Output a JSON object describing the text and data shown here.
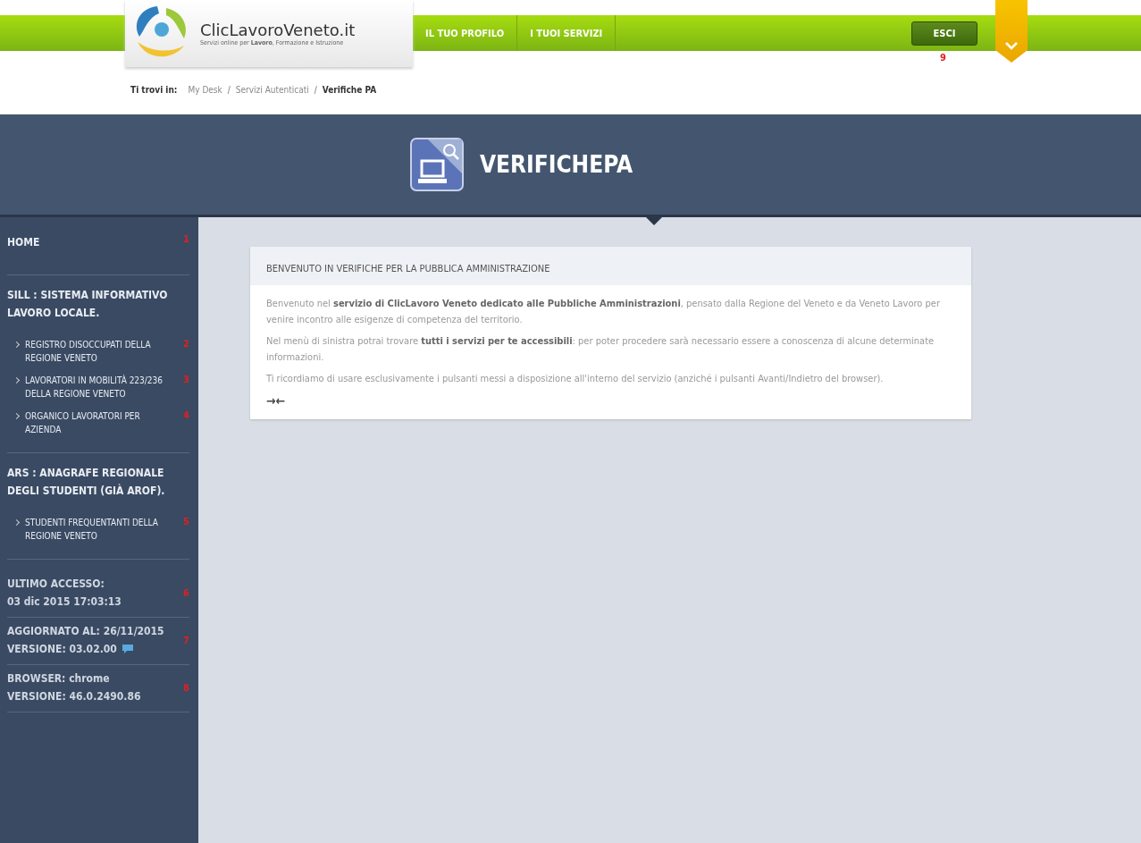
{
  "header": {
    "logo_title": "ClicLavoroVeneto.it",
    "logo_subtitle": "Servizi online per **Lavoro**, Formazione e Istruzione",
    "nav": [
      {
        "label": "IL TUO PROFILO"
      },
      {
        "label": "I TUOI SERVIZI"
      }
    ],
    "logout": {
      "label": "ESCI",
      "marker": "9"
    }
  },
  "breadcrumb": {
    "label": "Ti trovi in:",
    "items": [
      {
        "text": "My Desk",
        "current": false
      },
      {
        "text": "Servizi Autenticati",
        "current": false
      },
      {
        "text": "Verifiche PA",
        "current": true
      }
    ],
    "separator": "/"
  },
  "banner": {
    "title": "VERIFICHEPA"
  },
  "sidebar": {
    "sections": [
      {
        "title": "HOME",
        "marker": "1"
      },
      {
        "title": "SILL : SISTEMA INFORMATIVO LAVORO LOCALE.",
        "items": [
          {
            "label": "REGISTRO DISOCCUPATI DELLA REGIONE VENETO",
            "marker": "2"
          },
          {
            "label": "LAVORATORI IN MOBILITÀ 223/236 DELLA REGIONE VENETO",
            "marker": "3"
          },
          {
            "label": "ORGANICO LAVORATORI PER AZIENDA",
            "marker": "4"
          }
        ]
      },
      {
        "title": "ARS : ANAGRAFE REGIONALE DEGLI STUDENTI (GIÀ AROF).",
        "items": [
          {
            "label": "STUDENTI FREQUENTANTI DELLA REGIONE VENETO",
            "marker": "5"
          }
        ]
      }
    ],
    "info": [
      {
        "lines": [
          "ULTIMO ACCESSO:",
          "03 dic 2015 17:03:13"
        ],
        "marker": "6"
      },
      {
        "lines": [
          "AGGIORNATO AL: 26/11/2015",
          "VERSIONE: 03.02.00"
        ],
        "marker": "7",
        "comment_icon": true
      },
      {
        "lines": [
          "BROWSER: chrome",
          "VERSIONE: 46.0.2490.86"
        ],
        "marker": "8"
      }
    ]
  },
  "welcome": {
    "title": "BENVENUTO IN VERIFICHE PER LA PUBBLICA AMMINISTRAZIONE",
    "paragraphs": [
      "Benvenuto nel **servizio di ClicLavoro Veneto dedicato alle Pubbliche Amministrazioni**, pensato dalla Regione del Veneto e da Veneto Lavoro per venire incontro alle esigenze di competenza del territorio.",
      "Nel menù di sinistra potrai trovare **tutti i servizi per te accessibili**: per poter procedere sarà necessario essere a conoscenza di alcune determinate informazioni.",
      "Ti ricordiamo di usare esclusivamente i pulsanti messi a disposizione all'interno del servizio (anziché i pulsanti Avanti/Indietro del browser)."
    ],
    "collapse_icon": "→←"
  }
}
